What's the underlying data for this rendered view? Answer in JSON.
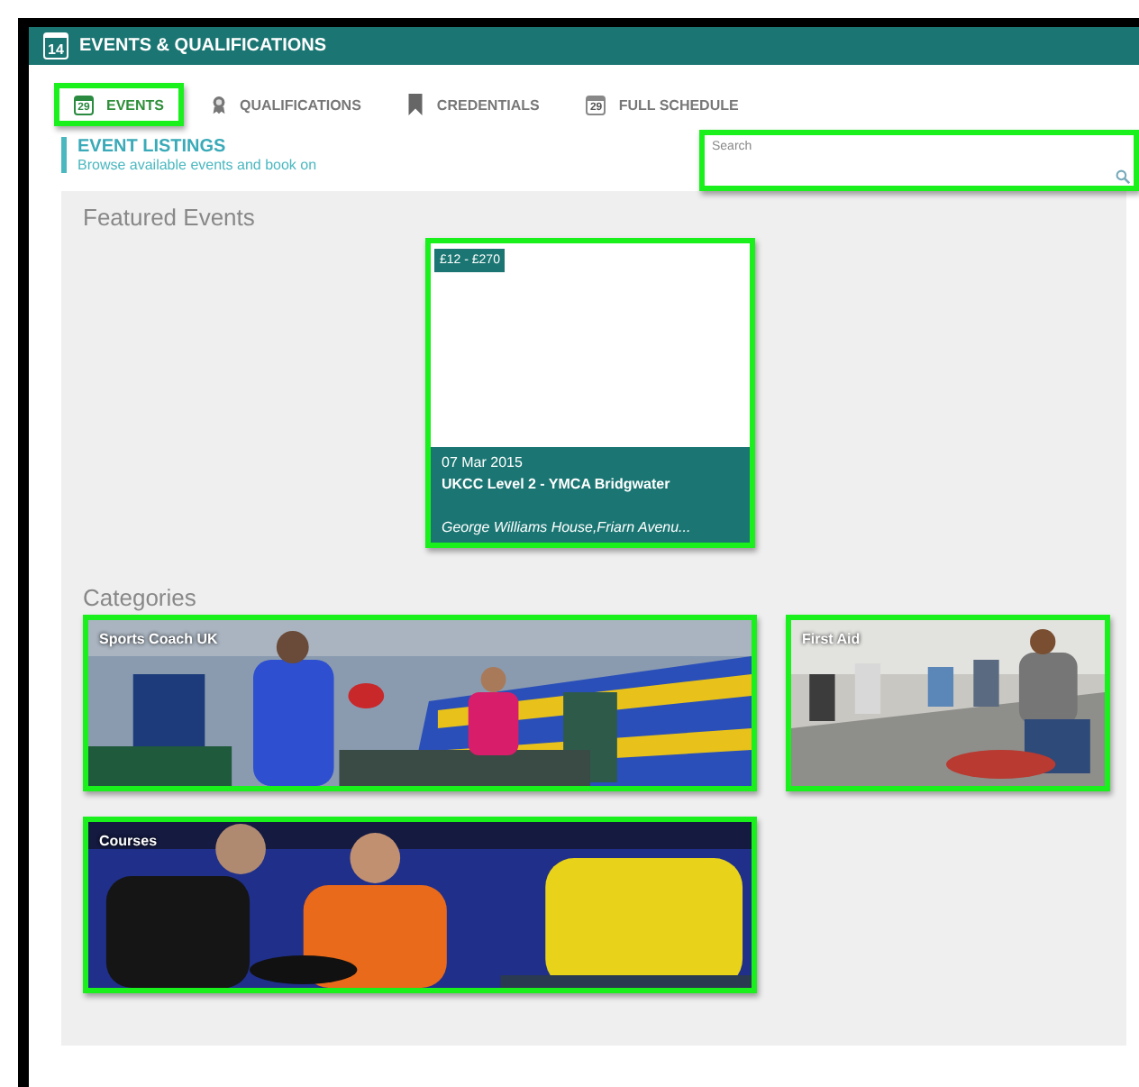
{
  "window": {
    "title": "EVENTS & QUALIFICATIONS",
    "day": "14"
  },
  "tabs": [
    {
      "label": "EVENTS",
      "kind": "calendar",
      "day": "29",
      "selected": true,
      "highlighted": true
    },
    {
      "label": "QUALIFICATIONS",
      "kind": "award",
      "selected": false,
      "highlighted": false
    },
    {
      "label": "CREDENTIALS",
      "kind": "bookmark",
      "selected": false,
      "highlighted": false
    },
    {
      "label": "FULL SCHEDULE",
      "kind": "calendar",
      "day": "29",
      "selected": false,
      "highlighted": false
    }
  ],
  "listings": {
    "title": "EVENT LISTINGS",
    "subtitle": "Browse available events and book on"
  },
  "search": {
    "placeholder": "Search",
    "highlighted": true
  },
  "featured": {
    "heading": "Featured Events",
    "events": [
      {
        "price": "£12 - £270",
        "date": "07 Mar 2015",
        "title": "UKCC Level 2 - YMCA Bridgwater",
        "venue": "George Williams House,Friarn Avenu...",
        "highlighted": true
      }
    ]
  },
  "categories": {
    "heading": "Categories",
    "items": [
      {
        "label": "Sports Coach UK",
        "kind": "picture",
        "highlighted": true
      },
      {
        "label": "First Aid",
        "kind": "picture",
        "highlighted": true
      },
      {
        "label": "Courses",
        "kind": "picture",
        "highlighted": true
      }
    ]
  }
}
